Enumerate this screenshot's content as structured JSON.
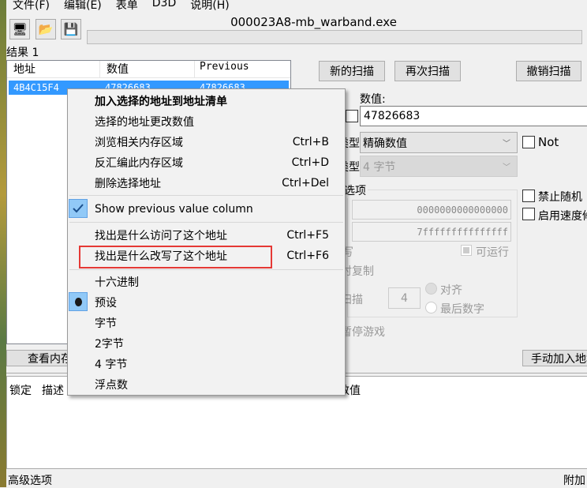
{
  "menubar": [
    "文件(F)",
    "编辑(E)",
    "表单",
    "D3D",
    "说明(H)"
  ],
  "title": "000023A8-mb_warband.exe",
  "results_label": "结果 1",
  "results": {
    "columns": [
      "地址",
      "数值",
      "Previous"
    ],
    "rows": [
      {
        "address": "4B4C15F4",
        "value": "47826683",
        "previous": "47826683"
      }
    ]
  },
  "buttons": {
    "new_scan": "新的扫描",
    "next_scan": "再次扫描",
    "undo_scan": "撤销扫描",
    "view_memory": "查看内存",
    "add_manual": "手动加入地址"
  },
  "value_label": "数值:",
  "value_input": "47826683",
  "scan_type_label": "扫描类型",
  "scan_type": "精确数值",
  "value_type_label": "数值类型",
  "value_type": "4 字节",
  "not_label": "Not",
  "scan_options": {
    "title": "内存扫描选项",
    "start": "0000000000000000",
    "stop": "7fffffffffffffff",
    "writable": "可写",
    "executable": "可运行",
    "copy_on_write": "写入时复制",
    "fast_scan": "快速扫描",
    "fast_scan_value": "4",
    "align": "对齐",
    "last_digits": "最后数字",
    "pause_game": "扫描时暂停游戏"
  },
  "right_options": [
    "禁止随机",
    "启用速度修改"
  ],
  "address_list": {
    "columns": [
      "锁定",
      "描述",
      "数值"
    ]
  },
  "status": {
    "left": "高级选项",
    "right": "附加"
  },
  "context_menu": [
    {
      "label": "加入选择的地址到地址清单",
      "shortcut": "",
      "bold": true
    },
    {
      "label": "选择的地址更改数值",
      "shortcut": ""
    },
    {
      "label": "浏览相关内存区域",
      "shortcut": "Ctrl+B"
    },
    {
      "label": "反汇编此内存区域",
      "shortcut": "Ctrl+D"
    },
    {
      "label": "删除选择地址",
      "shortcut": "Ctrl+Del"
    },
    {
      "label": "Show previous value column",
      "shortcut": "",
      "checked": true
    },
    {
      "label": "找出是什么访问了这个地址",
      "shortcut": "Ctrl+F5"
    },
    {
      "label": "找出是什么改写了这个地址",
      "shortcut": "Ctrl+F6",
      "highlighted_box": "#e53935"
    },
    {
      "label": "十六进制",
      "shortcut": ""
    },
    {
      "label": "预设",
      "shortcut": "",
      "radio": true
    },
    {
      "label": "字节",
      "shortcut": ""
    },
    {
      "label": "2字节",
      "shortcut": ""
    },
    {
      "label": "4 字节",
      "shortcut": ""
    },
    {
      "label": "浮点数",
      "shortcut": ""
    }
  ],
  "colors": {
    "selection": "#3399ff",
    "menu_check": "#91c9f7",
    "red_box": "#e53935"
  }
}
